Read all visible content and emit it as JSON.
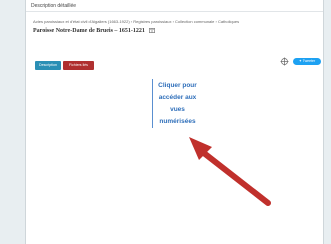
{
  "panel": {
    "title": "Description détaillée",
    "breadcrumb": "Actes paroissiaux et d'état civil d'Aigaliers (1663-1922) › Registres paroissiaux › Collection communale › Catholiques",
    "heading": "Paroisse Notre-Dame de Brueis – 1651-1221"
  },
  "tabs": [
    {
      "label": "Description",
      "color": "#2a8fb5"
    },
    {
      "label": "Fichiers liés",
      "color": "#b03030"
    }
  ],
  "share": {
    "tweet_label": "Tweeter",
    "tweet_color": "#1da1f2"
  },
  "callout": {
    "lines": [
      "Cliquer pour",
      "accéder aux",
      "vues",
      "numérisées"
    ],
    "color": "#2f6fba"
  },
  "annotation": {
    "arrow_color": "#c0302c"
  }
}
